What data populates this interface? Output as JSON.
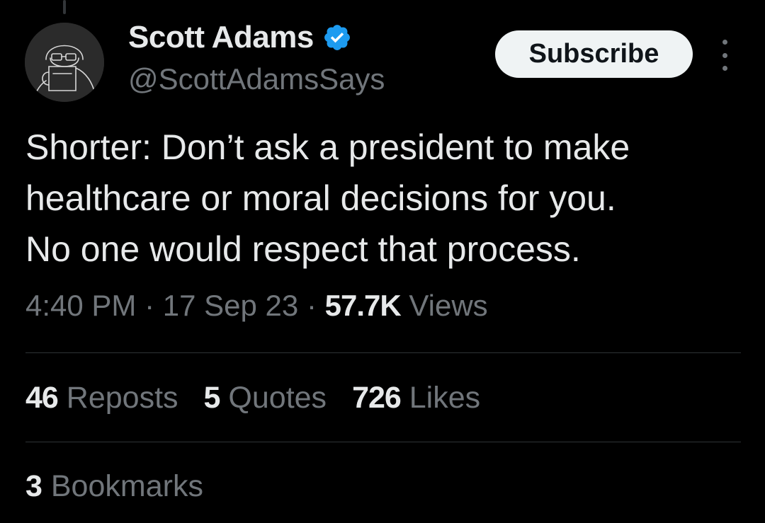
{
  "author": {
    "name": "Scott Adams",
    "handle": "@ScottAdamsSays",
    "verified_color": "#1d9bf0"
  },
  "actions": {
    "subscribe_label": "Subscribe",
    "more_icon": "more-vertical-icon"
  },
  "tweet": {
    "lines": [
      "Shorter: Don’t ask a president to make",
      "healthcare or moral decisions for you.",
      "No one would respect that process."
    ]
  },
  "meta": {
    "time": "4:40 PM",
    "separator": "·",
    "date": "17 Sep 23",
    "views_count": "57.7K",
    "views_label": "Views"
  },
  "stats": {
    "reposts_count": "46",
    "reposts_label": "Reposts",
    "quotes_count": "5",
    "quotes_label": "Quotes",
    "likes_count": "726",
    "likes_label": "Likes",
    "bookmarks_count": "3",
    "bookmarks_label": "Bookmarks"
  },
  "colors": {
    "background": "#000000",
    "primary_text": "#e7e9ea",
    "secondary_text": "#71767b",
    "divider": "#2f3336",
    "button_bg": "#eff3f4"
  }
}
